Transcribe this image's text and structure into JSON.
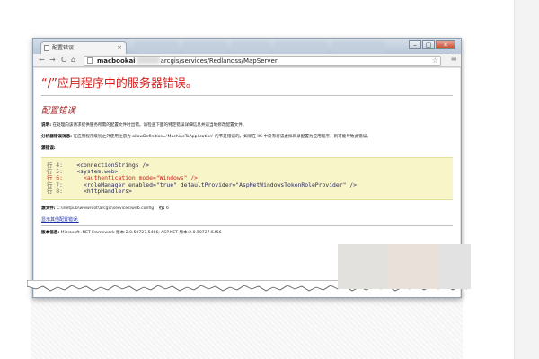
{
  "browser": {
    "tab_title": "配置错误",
    "tab_close": "×",
    "window_controls": {
      "minimize": "–",
      "restore": "▢",
      "close": "✕"
    },
    "nav": {
      "back": "←",
      "forward": "→",
      "reload": "C",
      "home": "⌂"
    },
    "url_host": "macbookai",
    "url_path": "arcgis/services/Redlandss/MapServer",
    "star": "☆",
    "menu": "≡"
  },
  "page": {
    "error_title": "“/”应用程序中的服务器错误。",
    "error_heading": "配置错误",
    "description_label": "说明:",
    "description_text": " 在处理向该请求提供服务所需的配置文件时出错。请检查下面的特定错误详细信息并适当地修改配置文件。",
    "parser_label": "分析器错误消息:",
    "parser_text": " 在应用程序级别之外使用注册为 allowDefinition='MachineToApplication' 的节是错误的。如果在 IIS 中没有将该虚拟目录配置为应用程序，则可能导致此错误。",
    "source_error_label": "源错误:",
    "code_lines": [
      {
        "num": "行 4:",
        "code": "    <connectionStrings />",
        "error": false
      },
      {
        "num": "行 5:",
        "code": "    <system.web>",
        "error": false
      },
      {
        "num": "行 6:",
        "code": "      <authentication mode=\"Windows\" />",
        "error": true
      },
      {
        "num": "行 7:",
        "code": "      <roleManager enabled=\"true\" defaultProvider=\"AspNetWindowsTokenRoleProvider\" />",
        "error": false
      },
      {
        "num": "行 8:",
        "code": "      <httpHandlers>",
        "error": false
      }
    ],
    "source_file_label": "源文件:",
    "source_file_path": " C:\\inetpub\\wwwroot\\arcgis\\services\\web.config",
    "line_label": "行:",
    "line_value": " 6",
    "show_config_link": "显示其他配置错误:",
    "version_label": "版本信息:",
    "version_text": " Microsoft .NET Framework 版本:2.0.50727.5466; ASP.NET 版本:2.0.50727.5456"
  }
}
